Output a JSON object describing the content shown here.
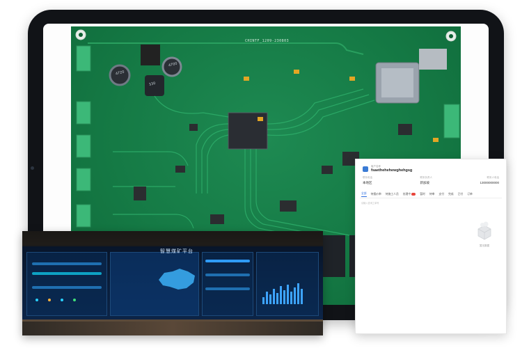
{
  "pcb": {
    "board_label": "CHINTF_1209-230803",
    "chip_marks": [
      "4720",
      "4700",
      "330"
    ]
  },
  "control_room": {
    "platform_title": "智慧煤矿平台"
  },
  "mobile": {
    "header_caption": "客户名称",
    "company_name": "fsaethehehewghehgsg",
    "fields": [
      {
        "label": "联系电话",
        "value": "本地区"
      },
      {
        "label": "联系负责人",
        "value": "新加坡"
      },
      {
        "label": "联系人电话",
        "value": "13000000000"
      }
    ],
    "tabs": [
      "全部",
      "待报价审",
      "待施工人员",
      "处理中",
      "暂时",
      "待审",
      "支付",
      "完成",
      "已付",
      "订单"
    ],
    "search_placeholder": "请输入查询工单号",
    "empty_text": "暂无数据",
    "colors": {
      "accent": "#2f6fe0",
      "badge": "#e8453c"
    }
  }
}
